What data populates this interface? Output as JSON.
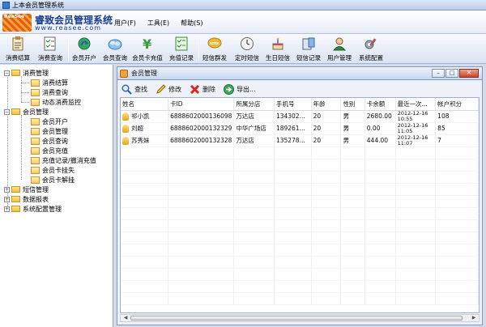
{
  "app": {
    "window_title": "上本会员管理系统",
    "logo_mark": "ReaSee",
    "logo_name": "睿致会员管理系统",
    "logo_url": "www.reasee.com"
  },
  "menu": [
    "用户(F)",
    "工具(E)",
    "帮助(S)"
  ],
  "toolbar": [
    {
      "label": "消费结算",
      "icon": "clipboard-icon"
    },
    {
      "label": "消费查询",
      "icon": "list-check-icon"
    },
    {
      "label": "会员开户",
      "icon": "add-member-icon"
    },
    {
      "label": "会员查询",
      "icon": "members-search-icon"
    },
    {
      "label": "会员卡充值",
      "icon": "yen-icon"
    },
    {
      "label": "充值记录",
      "icon": "record-list-icon"
    },
    {
      "label": "短信群发",
      "icon": "sms-icon"
    },
    {
      "label": "定时短信",
      "icon": "clock-icon"
    },
    {
      "label": "生日短信",
      "icon": "birthday-icon"
    },
    {
      "label": "短信记录",
      "icon": "message-log-icon"
    },
    {
      "label": "用户管理",
      "icon": "user-icon"
    },
    {
      "label": "系统配置",
      "icon": "settings-icon"
    }
  ],
  "tree": {
    "groups": [
      {
        "label": "消费管理",
        "expanded": true,
        "items": [
          "消费结算",
          "消费查询",
          "动态消费监控"
        ]
      },
      {
        "label": "会员管理",
        "expanded": true,
        "items": [
          "会员开户",
          "会员管理",
          "会员查询",
          "会员充值",
          "充值记录/撤消充值",
          "会员卡挂失",
          "会员卡解挂"
        ]
      },
      {
        "label": "短信管理",
        "expanded": false,
        "items": []
      },
      {
        "label": "数据报表",
        "expanded": false,
        "items": []
      },
      {
        "label": "系统配置管理",
        "expanded": false,
        "items": []
      }
    ]
  },
  "member_window": {
    "title": "会员管理",
    "buttons": [
      "查找",
      "修改",
      "删除",
      "导出..."
    ],
    "columns": [
      "姓名",
      "卡ID",
      "所属分店",
      "手机号",
      "年龄",
      "性别",
      "卡余额",
      "最近一次...",
      "帐户积分"
    ],
    "rows": [
      {
        "name": "祁小凯",
        "card": "6888602000136098",
        "branch": "万达店",
        "phone": "134302...",
        "age": "20",
        "gender": "男",
        "balance": "2680.00",
        "date": "2012-12-16",
        "time": "10:55",
        "points": "108"
      },
      {
        "name": "刘超",
        "card": "6888602000132329",
        "branch": "中华广场店",
        "phone": "189261...",
        "age": "20",
        "gender": "男",
        "balance": "0.00",
        "date": "2012-12-16",
        "time": "11:05",
        "points": "85"
      },
      {
        "name": "苏秀妹",
        "card": "6888602000132328",
        "branch": "万达店",
        "phone": "135278...",
        "age": "20",
        "gender": "男",
        "balance": "444.00",
        "date": "2012-12-16",
        "time": "11:07",
        "points": "7"
      }
    ]
  }
}
